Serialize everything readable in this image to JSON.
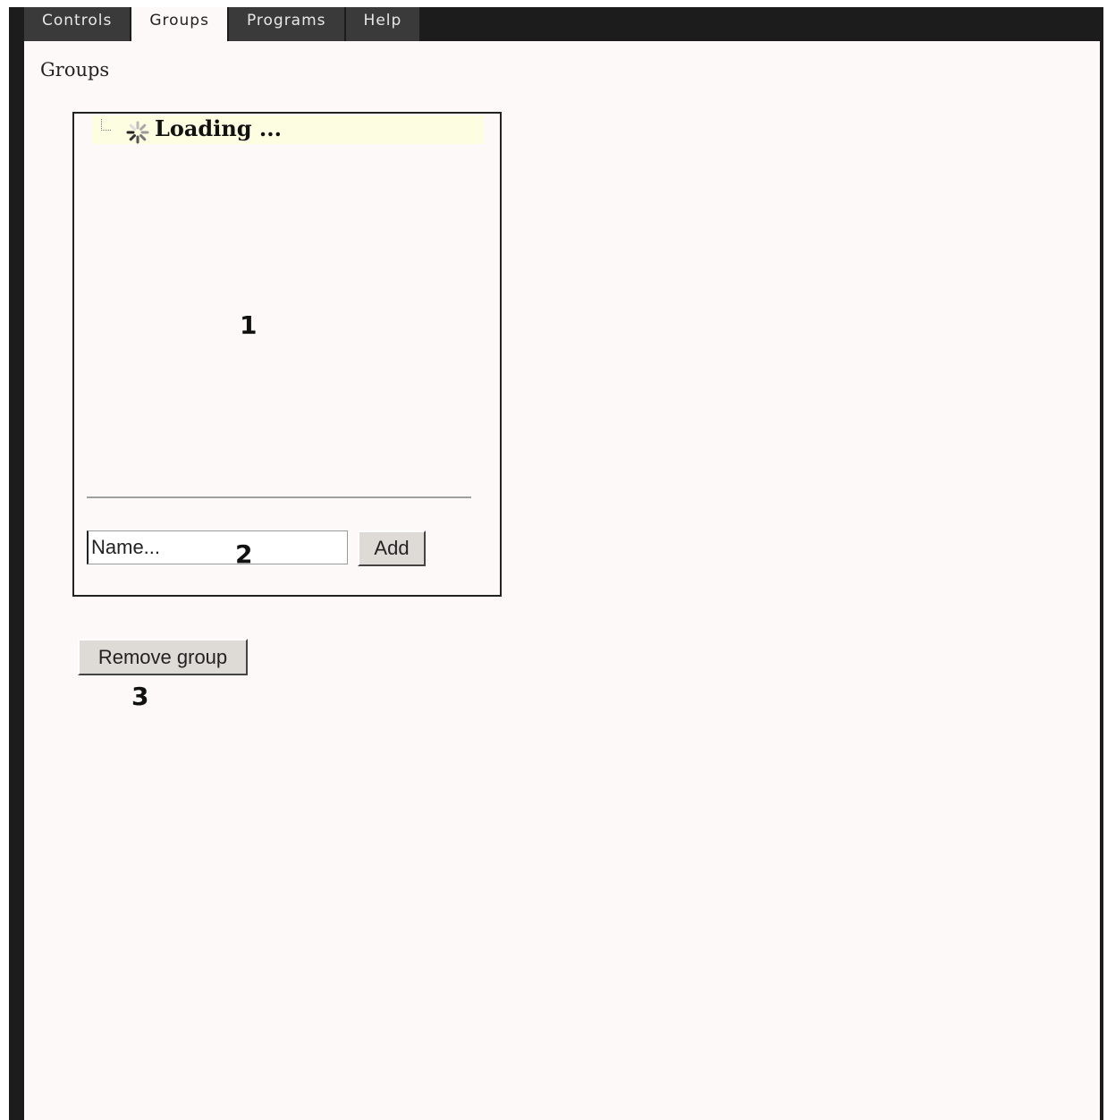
{
  "tabs": [
    {
      "label": "Controls"
    },
    {
      "label": "Groups"
    },
    {
      "label": "Programs"
    },
    {
      "label": "Help"
    }
  ],
  "active_tab": "Groups",
  "page": {
    "title": "Groups"
  },
  "tree": {
    "loading_label": "Loading ..."
  },
  "add_group": {
    "name_placeholder": "Name...",
    "add_label": "Add"
  },
  "remove_group": {
    "label": "Remove group"
  },
  "annotations": {
    "one": "1",
    "two": "2",
    "three": "3"
  },
  "colors": {
    "frame": "#1c1c1c",
    "tab_inactive": "#3a3a3a",
    "content_bg": "#fdf9f8",
    "tree_row_bg": "#fdfde2"
  }
}
